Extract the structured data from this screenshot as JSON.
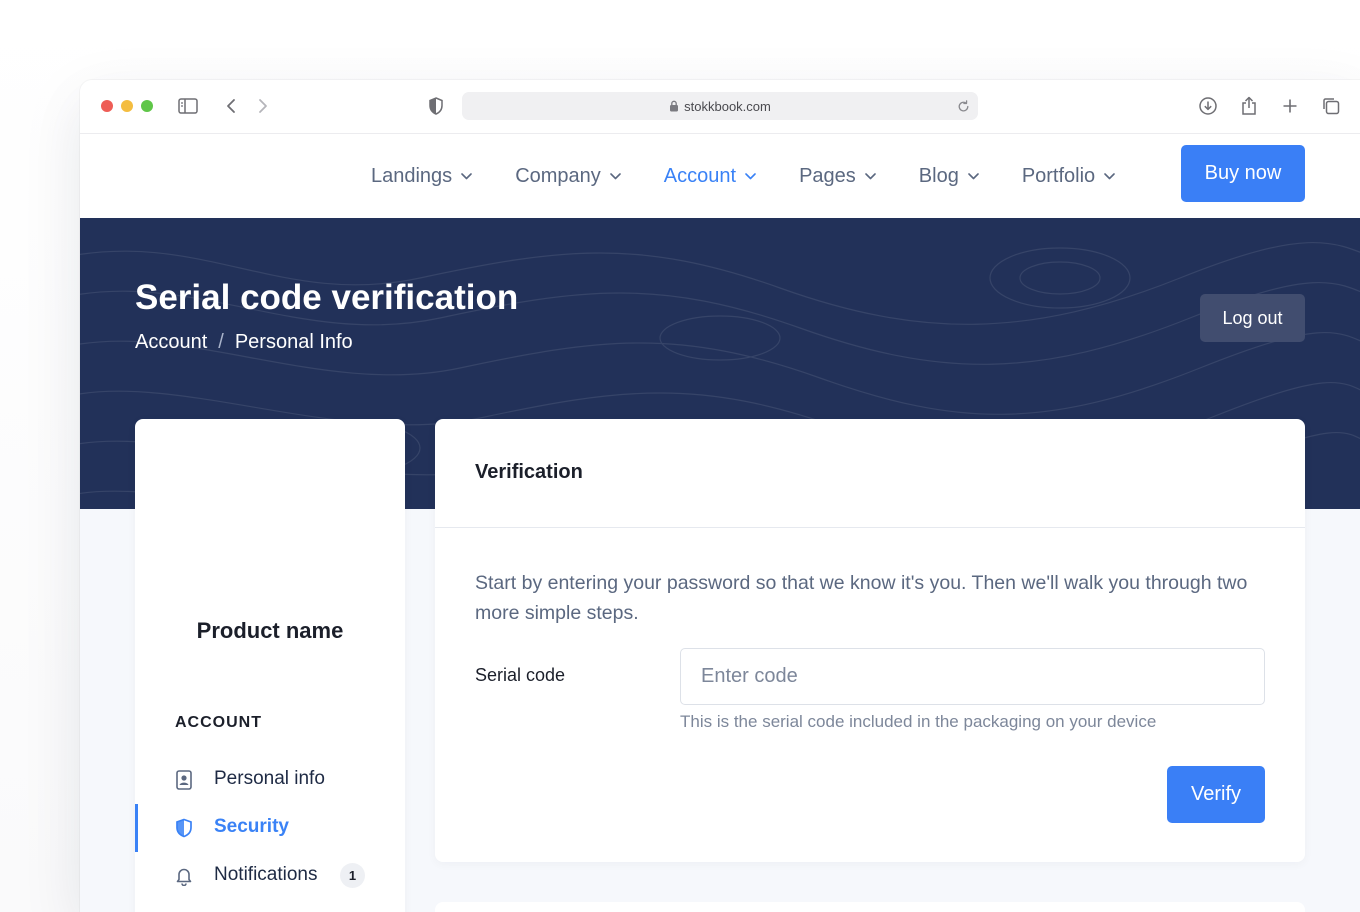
{
  "browser": {
    "url": "stokkbook.com"
  },
  "nav": {
    "links": [
      {
        "label": "Landings",
        "active": false
      },
      {
        "label": "Company",
        "active": false
      },
      {
        "label": "Account",
        "active": true
      },
      {
        "label": "Pages",
        "active": false
      },
      {
        "label": "Blog",
        "active": false
      },
      {
        "label": "Portfolio",
        "active": false
      }
    ],
    "cta_label": "Buy now"
  },
  "hero": {
    "title": "Serial code verification",
    "breadcrumb": [
      "Account",
      "Personal Info"
    ],
    "breadcrumb_separator": "/",
    "logout_label": "Log out"
  },
  "sidebar": {
    "product_name": "Product name",
    "section_title": "ACCOUNT",
    "items": [
      {
        "label": "Personal info",
        "icon": "id-card-icon",
        "active": false
      },
      {
        "label": "Security",
        "icon": "shield-icon",
        "active": true
      },
      {
        "label": "Notifications",
        "icon": "bell-icon",
        "active": false,
        "badge": "1"
      }
    ]
  },
  "main": {
    "card_title": "Verification",
    "description": "Start by entering your password so that we know it's you. Then we'll walk you through two more simple steps.",
    "field_label": "Serial code",
    "input_value": "",
    "input_placeholder": "Enter code",
    "help_text": "This is the serial code included in the packaging on your device",
    "verify_label": "Verify"
  },
  "colors": {
    "accent": "#3a7ff6",
    "hero_bg": "#223159",
    "page_bg": "#f6f8fc",
    "text_muted": "#5b6880"
  }
}
